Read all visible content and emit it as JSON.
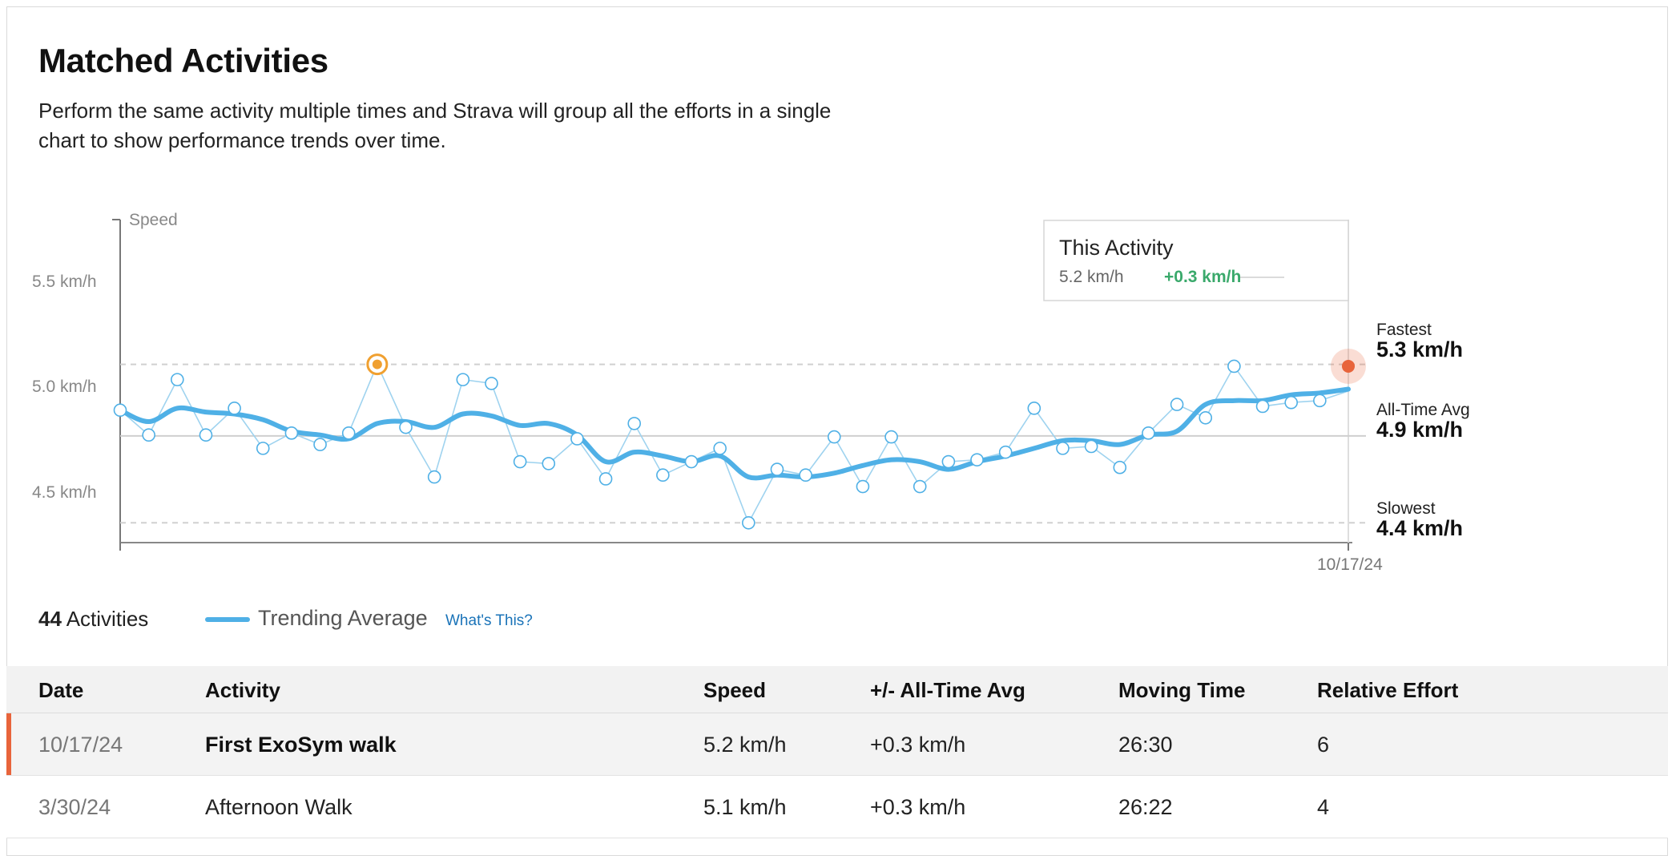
{
  "header": {
    "title": "Matched Activities",
    "description": "Perform the same activity multiple times and Strava will group all the efforts in a single chart to show performance trends over time."
  },
  "chart_data": {
    "type": "line",
    "ylabel": "Speed",
    "y_ticks": [
      "5.5 km/h",
      "5.0 km/h",
      "4.5 km/h"
    ],
    "ylim": [
      4.28,
      5.72
    ],
    "x_tick_label": "10/17/24",
    "grid": true,
    "series": [
      {
        "name": "Trending Average",
        "color": "#4fb0e6",
        "values": [
          5.02,
          4.96,
          5.03,
          5.01,
          5.0,
          4.97,
          4.91,
          4.89,
          4.87,
          4.95,
          4.96,
          4.93,
          5.0,
          4.99,
          4.94,
          4.95,
          4.89,
          4.75,
          4.8,
          4.78,
          4.75,
          4.78,
          4.67,
          4.68,
          4.67,
          4.69,
          4.73,
          4.76,
          4.75,
          4.71,
          4.75,
          4.78,
          4.82,
          4.86,
          4.86,
          4.84,
          4.89,
          4.91,
          5.05,
          5.07,
          5.07,
          5.1,
          5.11,
          5.13
        ]
      },
      {
        "name": "activity-efforts",
        "color": "#9fd3ef",
        "values": [
          5.02,
          4.89,
          5.18,
          4.89,
          5.03,
          4.82,
          4.9,
          4.84,
          4.9,
          5.26,
          4.93,
          4.67,
          5.18,
          5.16,
          4.75,
          4.74,
          4.87,
          4.66,
          4.95,
          4.68,
          4.75,
          4.82,
          4.43,
          4.71,
          4.68,
          4.88,
          4.62,
          4.88,
          4.62,
          4.75,
          4.76,
          4.8,
          5.03,
          4.82,
          4.83,
          4.72,
          4.9,
          5.05,
          4.98,
          5.25,
          5.04,
          5.06,
          5.07,
          5.12
        ]
      }
    ],
    "highlight_index": 9,
    "current": {
      "speed": 5.25
    },
    "reference_lines": [
      {
        "label": "Fastest",
        "value_label": "5.3 km/h",
        "value": 5.26,
        "style": "dashed"
      },
      {
        "label": "All-Time Avg",
        "value_label": "4.9 km/h",
        "value": 4.885,
        "style": "solid"
      },
      {
        "label": "Slowest",
        "value_label": "4.4 km/h",
        "value": 4.43,
        "style": "dashed"
      }
    ],
    "tooltip": {
      "title": "This Activity",
      "speed": "5.2 km/h",
      "delta": "+0.3 km/h"
    }
  },
  "colors": {
    "trend": "#4fb0e6",
    "points": "#9fd3ef",
    "highlight": "#f0a030",
    "current": "#e8643b",
    "positive": "#3aa96b"
  },
  "summary": {
    "count": "44",
    "count_label": "Activities",
    "legend_label": "Trending Average",
    "whats_this": "What's This?"
  },
  "table": {
    "headers": [
      "Date",
      "Activity",
      "Speed",
      "+/- All-Time Avg",
      "Moving Time",
      "Relative Effort"
    ],
    "rows": [
      {
        "date": "10/17/24",
        "activity": "First ExoSym walk",
        "speed": "5.2 km/h",
        "delta": "+0.3 km/h",
        "moving_time": "26:30",
        "relative_effort": "6",
        "selected": true
      },
      {
        "date": "3/30/24",
        "activity": "Afternoon Walk",
        "speed": "5.1 km/h",
        "delta": "+0.3 km/h",
        "moving_time": "26:22",
        "relative_effort": "4",
        "selected": false
      }
    ]
  }
}
